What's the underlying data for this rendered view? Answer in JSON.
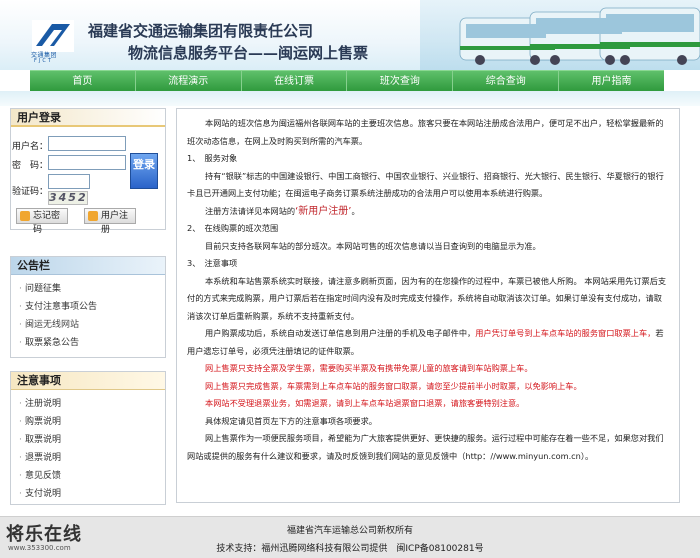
{
  "header": {
    "company": "福建省交通运输集团有限责任公司",
    "platform": "物流信息服务平台——闽运网上售票",
    "logo_text": "交通集团",
    "logo_sub": "FJCT"
  },
  "nav": [
    "首页",
    "流程演示",
    "在线订票",
    "班次查询",
    "综合查询",
    "用户指南"
  ],
  "login": {
    "title": "用户登录",
    "user_label": "用户名：",
    "pass_label": "密　码：",
    "code_label": "验证码：",
    "login_btn": "登录",
    "captcha": "3452",
    "forgot_btn": "忘记密码",
    "register_btn": "用户注册"
  },
  "notice": {
    "title": "公告栏",
    "items": [
      "问题征集",
      "支付注意事项公告",
      "闽运无线网站",
      "取票紧急公告"
    ]
  },
  "tips": {
    "title": "注意事项",
    "items": [
      "注册说明",
      "购票说明",
      "取票说明",
      "退票说明",
      "意见反馈",
      "支付说明"
    ]
  },
  "main": {
    "p1": "本网站的班次信息为闽运福州各联网车站的主要班次信息。旅客只要在本网站注册成合法用户，便可足不出户，轻松掌握最新的班次动态信息，在网上及时购买到所需的汽车票。",
    "s1": "1、　服务对象",
    "p2": "持有“银联”标志的中国建设银行、中国工商银行、中国农业银行、兴业银行、招商银行、光大银行、民生银行、华夏银行的银行卡且已开通网上支付功能；在闽运电子商务订票系统注册成功的合法用户可以使用本系统进行购票。",
    "p3a": "注册方法请详见本网站的",
    "p3link": "‘新用户注册’",
    "p3b": "。",
    "s2": "2、　在线购票的班次范围",
    "p4": "目前只支持各联网车站的部分班次。本网站可售的班次信息请以当日查询到的电脑显示为准。",
    "s3": "3、　注意事项",
    "p5": "本系统和车站售票系统实时联接，请注意多刷新页面，因为有的在您操作的过程中，车票已被他人所购。 本网站采用先订票后支付的方式来完成购票，用户订票后若在指定时间内没有及时完成支付操作，系统将自动取消该次订单。如果订单没有支付成功，请取消该次订单后重新购票，系统不支持重新支付。",
    "p6a": "用户购票成功后，系统自动发送订单信息到用户注册的手机及电子邮件中，",
    "p6red": "用户凭订单号到上车点车站的服务窗口取票上车，",
    "p6b": "若用户遗忘订单号，必须凭注册填记的证件取票。",
    "r1": "网上售票只支持全票及学生票，需要购买半票及有携带免票儿童的旅客请到车站购票上车。",
    "r2": "网上售票只完成售票，车票需到上车点车站的服务窗口取票，请您至少提前半小时取票，以免影响上车。",
    "r3": "本网站不受理退票业务，如需退票，请到上车点车站退票窗口退票，请旅客要特别注意。",
    "p7": "具体规定请见首页左下方的注意事项各项要求。",
    "p8": "网上售票作为一项便民服务项目，希望能为广大旅客提供更好、更快捷的服务。运行过程中可能存在着一些不足，如果您对我们网站或提供的服务有什么建议和要求，请及时反馈到我们网站的意见反馈中（http：//www.minyun.com.cn）。"
  },
  "footer": {
    "line1": "福建省汽车运输总公司新权所有",
    "line2": "技术支持：福州迅腾网络科技有限公司提供　闽ICP备08100281号"
  },
  "watermark": {
    "text": "将乐在线",
    "url": "www.353300.com"
  }
}
